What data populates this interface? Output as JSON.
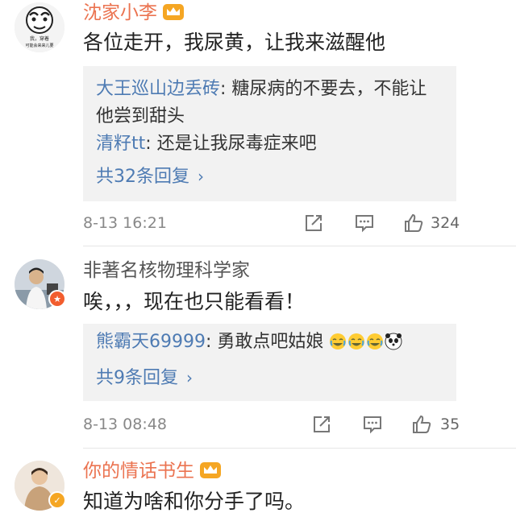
{
  "comments": [
    {
      "author": "沈家小李",
      "text": "各位走开，我尿黄，让我来滋醒他",
      "avatar_caption_line1": "我，穿着",
      "avatar_caption_line2": "可能会来来儿要",
      "replies": [
        {
          "name": "大王巡山边丢砖",
          "text_line1": ": 糖尿病的不要去，不能让",
          "text_line2": "他尝到甜头"
        },
        {
          "name": "清籽tt",
          "text_line1": ": 还是让我尿毒症来吧"
        }
      ],
      "more_replies": "共32条回复",
      "time": "8-13 16:21",
      "likes": "324"
    },
    {
      "author": "非著名核物理科学家",
      "text": "唉，，，现在也只能看看！",
      "replies": [
        {
          "name": "熊霸天69999",
          "text_line1": ": 勇敢点吧姑娘"
        }
      ],
      "more_replies": "共9条回复",
      "time": "8-13 08:48",
      "likes": "35"
    },
    {
      "author": "你的情话书生",
      "text": "知道为啥和你分手了吗。"
    }
  ],
  "icons": {
    "chevron": "chevron-right-icon",
    "repost": "repost-icon",
    "comment": "comment-icon",
    "like": "thumbs-up-icon",
    "crown": "vip-crown-icon"
  },
  "colors": {
    "vip_name": "#eb7350",
    "link": "#4e7bb3",
    "reply_bg": "#f2f2f2"
  }
}
